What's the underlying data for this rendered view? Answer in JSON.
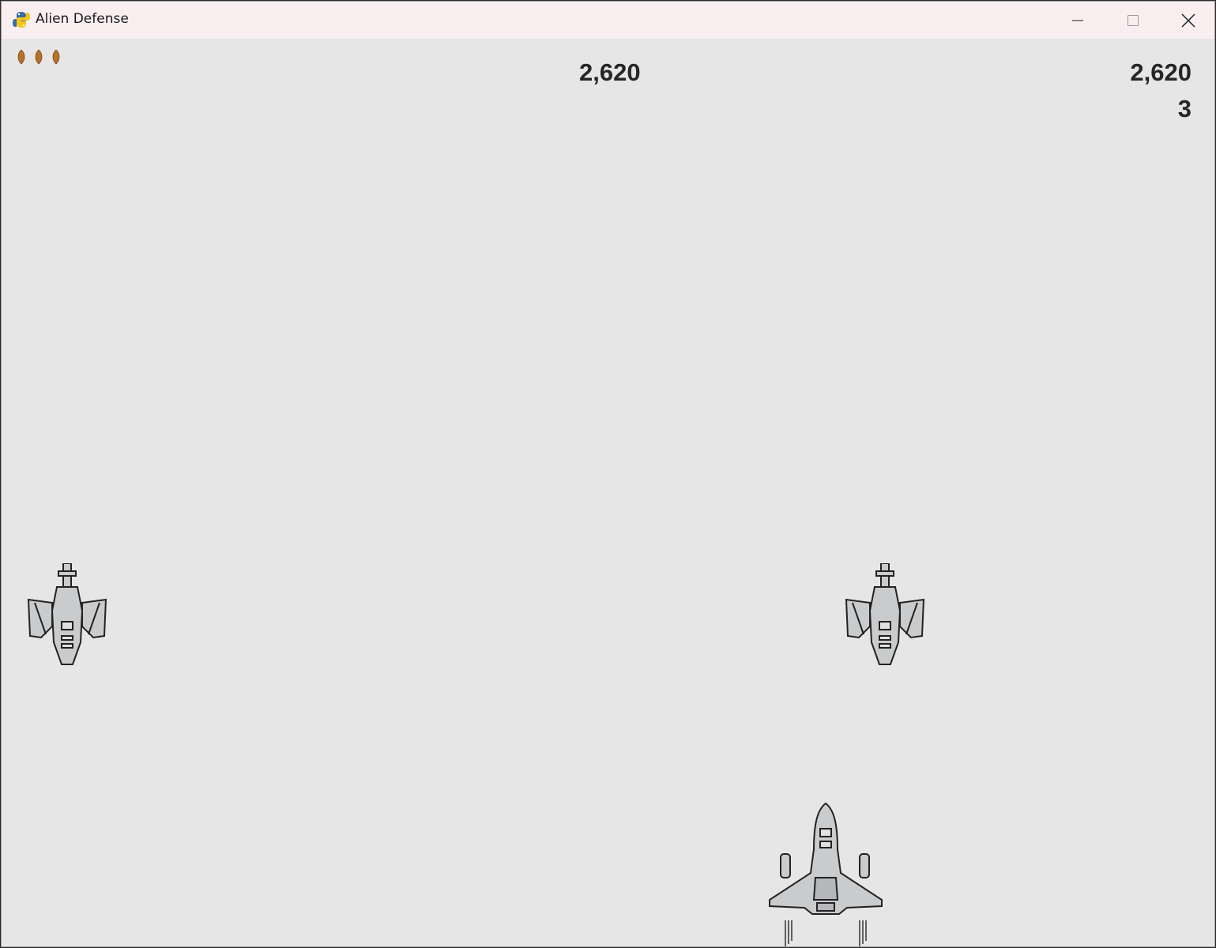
{
  "window": {
    "title": "Alien Defense",
    "app_icon": "python-snake-icon",
    "controls": [
      "minimize-icon",
      "maximize-icon",
      "close-icon"
    ]
  },
  "hud": {
    "score": "2,620",
    "high_score": "2,620",
    "level": "3",
    "lives": 3
  },
  "sprites": {
    "aliens": [
      "alien-ship",
      "alien-ship"
    ],
    "player": "player-ship"
  },
  "colors": {
    "background": "#e6e6e6",
    "titlebar": "#f9eff1",
    "life_icon": "#b8702a",
    "text": "#262626"
  }
}
